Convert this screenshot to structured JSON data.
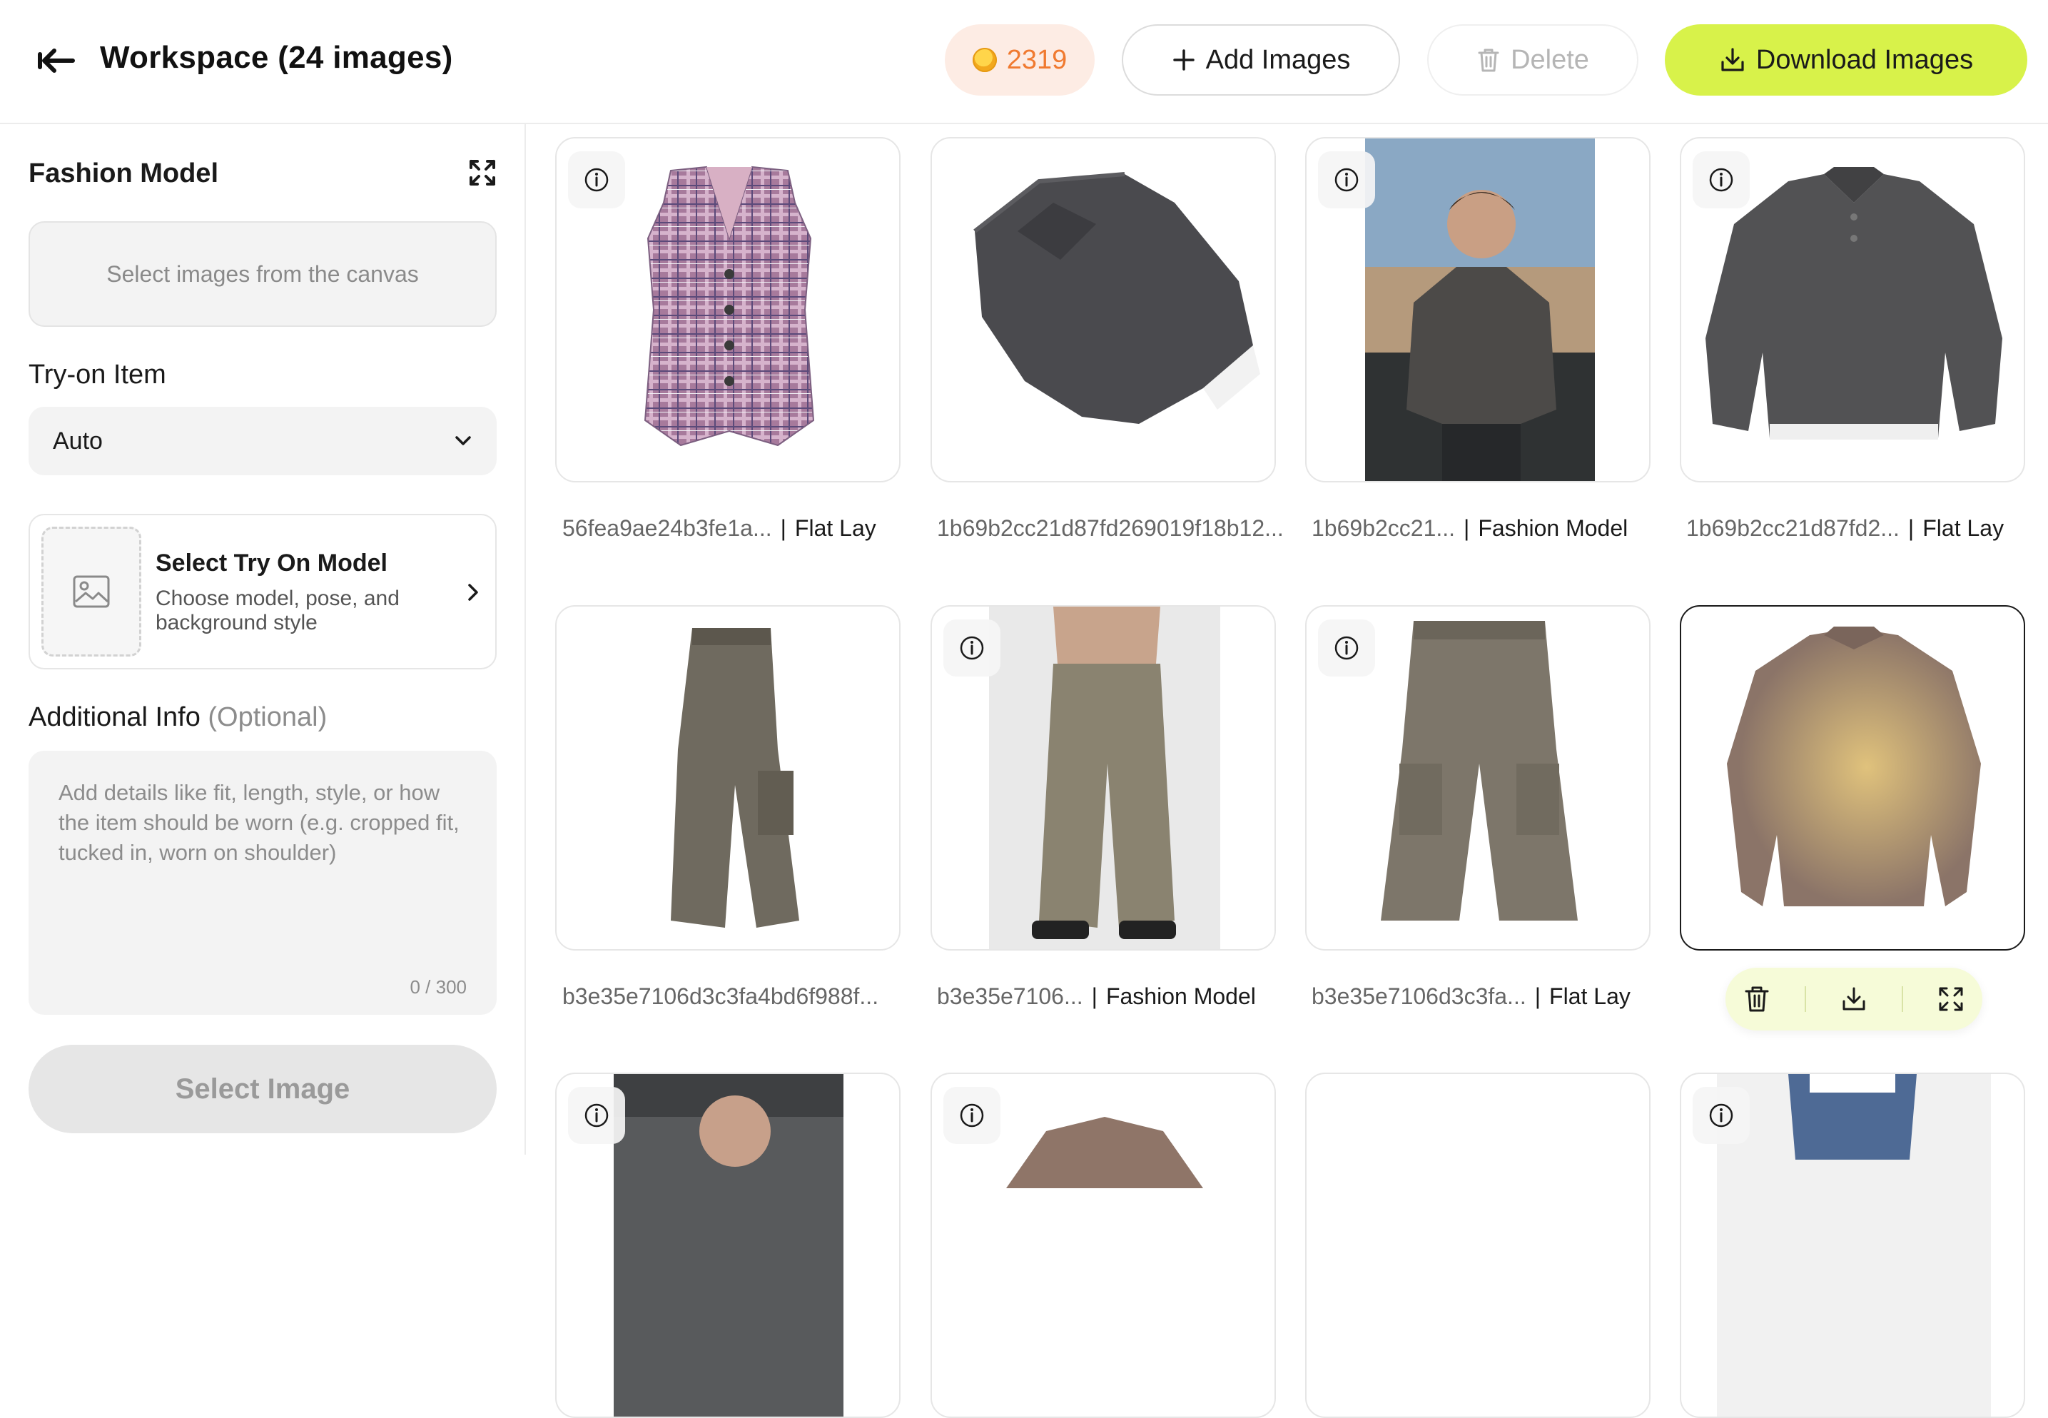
{
  "header": {
    "title": "Workspace (24 images)",
    "credits": "2319",
    "add_label": "Add Images",
    "delete_label": "Delete",
    "download_label": "Download Images"
  },
  "sidebar": {
    "panel_title": "Fashion Model",
    "select_placeholder": "Select images from the canvas",
    "tryon_label": "Try-on Item",
    "tryon_value": "Auto",
    "model_title": "Select Try On Model",
    "model_subtitle": "Choose model, pose, and background style",
    "additional_label": "Additional Info",
    "additional_optional": "(Optional)",
    "additional_placeholder": "Add details like fit, length, style, or how the item should be worn (e.g. cropped fit, tucked in, worn on shoulder)",
    "char_count": "0 / 300",
    "select_button": "Select Image"
  },
  "grid": {
    "items": [
      {
        "name": "56fea9ae24b3fe1a...",
        "tag": "Flat Lay"
      },
      {
        "name": "1b69b2cc21d87fd269019f18b12...",
        "tag": ""
      },
      {
        "name": "1b69b2cc21...",
        "tag": "Fashion Model"
      },
      {
        "name": "1b69b2cc21d87fd2...",
        "tag": "Flat Lay"
      },
      {
        "name": "b3e35e7106d3c3fa4bd6f988f...",
        "tag": ""
      },
      {
        "name": "b3e35e7106...",
        "tag": "Fashion Model"
      },
      {
        "name": "b3e35e7106d3c3fa...",
        "tag": "Flat Lay"
      }
    ]
  },
  "colors": {
    "accent": "#d8f24a",
    "credits_bg": "#fdece4",
    "credits_text": "#f07a30"
  }
}
